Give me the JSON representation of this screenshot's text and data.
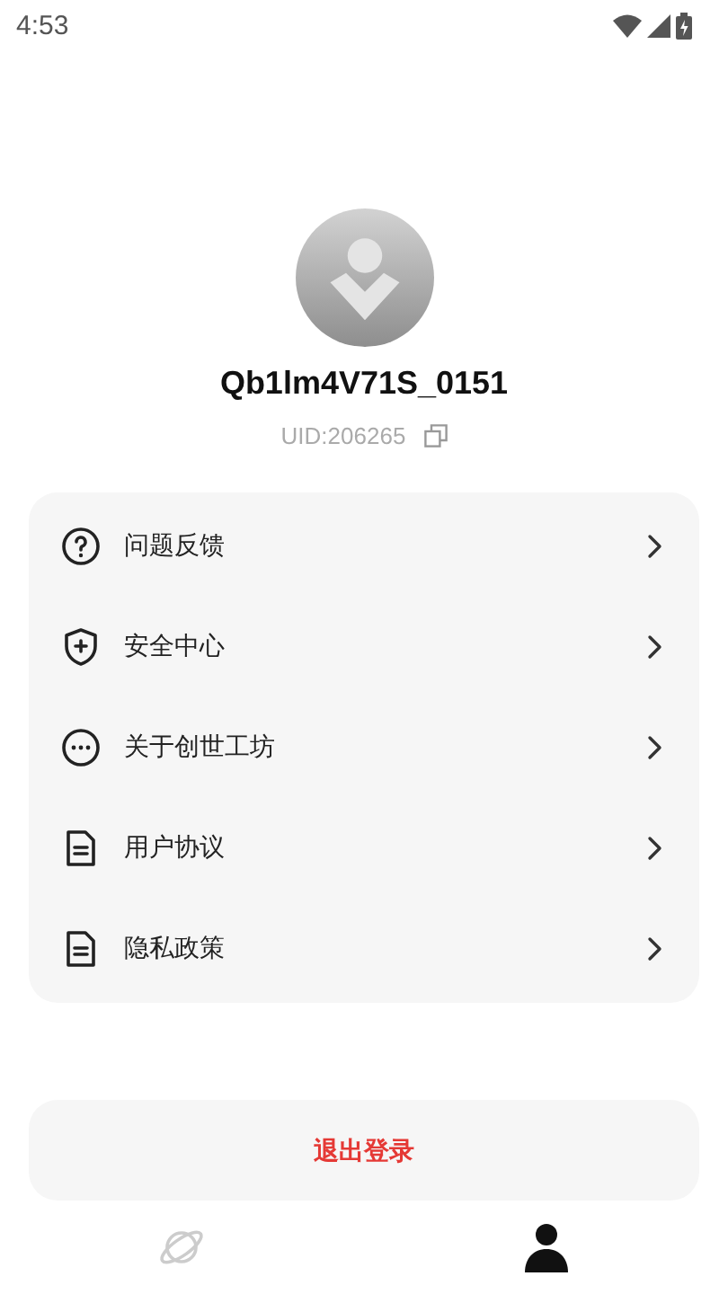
{
  "status_bar": {
    "time": "4:53"
  },
  "profile": {
    "username": "Qb1lm4V71S_0151",
    "uid": "UID:206265"
  },
  "menu": [
    {
      "kind": "help",
      "label": "问题反馈"
    },
    {
      "kind": "shield",
      "label": "安全中心"
    },
    {
      "kind": "more",
      "label": "关于创世工坊"
    },
    {
      "kind": "document",
      "label": "用户协议"
    },
    {
      "kind": "document",
      "label": "隐私政策"
    }
  ],
  "logout_button": {
    "label": "退出登录"
  },
  "bottom_nav": [
    {
      "kind": "planet",
      "selected": false
    },
    {
      "kind": "person",
      "selected": true
    }
  ]
}
